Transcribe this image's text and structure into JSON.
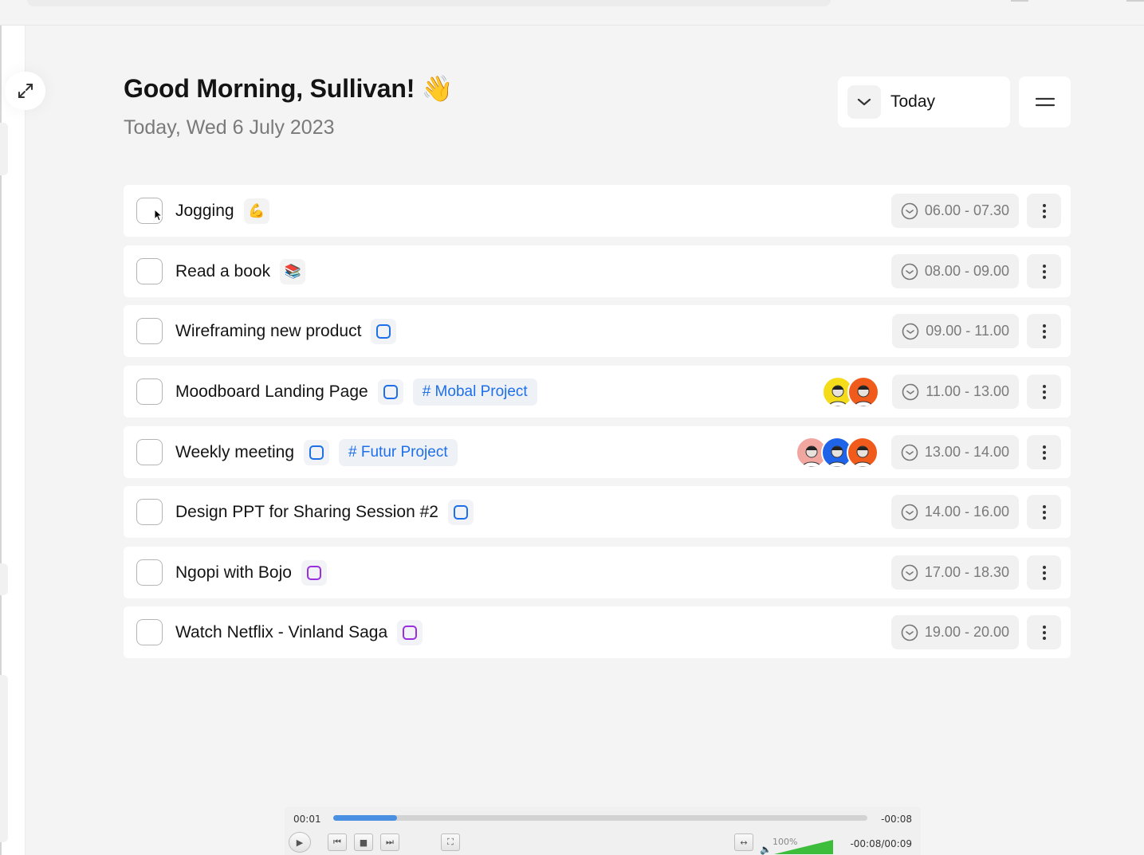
{
  "header": {
    "greeting": "Good Morning, Sullivan! 👋",
    "date": "Today, Wed 6 July 2023",
    "filter_label": "Today",
    "filter_icon": "chevron-down-icon",
    "menu_icon": "hamburger-icon"
  },
  "tasks": [
    {
      "title": "Jogging",
      "chip": "emoji",
      "emoji": "💪",
      "time": "06.00 - 07.30",
      "checked": false
    },
    {
      "title": "Read a book",
      "chip": "emoji",
      "emoji": "📚",
      "time": "08.00 - 09.00",
      "checked": false
    },
    {
      "title": "Wireframing new product",
      "chip": "blue-square",
      "time": "09.00 - 11.00",
      "checked": false
    },
    {
      "title": "Moodboard Landing Page",
      "chip": "blue-square",
      "tag": "# Mobal Project",
      "avatars": 2,
      "time": "11.00 - 13.00",
      "checked": false
    },
    {
      "title": "Weekly meeting",
      "chip": "blue-square",
      "tag": "# Futur Project",
      "avatars": 3,
      "time": "13.00 - 14.00",
      "checked": false
    },
    {
      "title": "Design PPT for Sharing Session #2",
      "chip": "blue-square",
      "time": "14.00 - 16.00",
      "checked": false
    },
    {
      "title": "Ngopi with Bojo",
      "chip": "purple-square",
      "time": "17.00 - 18.30",
      "checked": false
    },
    {
      "title": "Watch Netflix - Vinland Saga",
      "chip": "purple-square",
      "time": "19.00 - 20.00",
      "checked": false
    }
  ],
  "colors": {
    "accent_blue": "#1e6fe8",
    "accent_purple": "#9b2fe0",
    "avatar_yellow": "#f5dc1b",
    "avatar_orange": "#f05a1a",
    "avatar_blue": "#1e63e8",
    "avatar_pink": "#f1a7a0"
  },
  "player": {
    "position": "00:01",
    "remaining": "-00:08",
    "progress": 0.12,
    "volume_label": "100%",
    "volume_level": 1.0,
    "durations": "-00:08/00:09"
  }
}
